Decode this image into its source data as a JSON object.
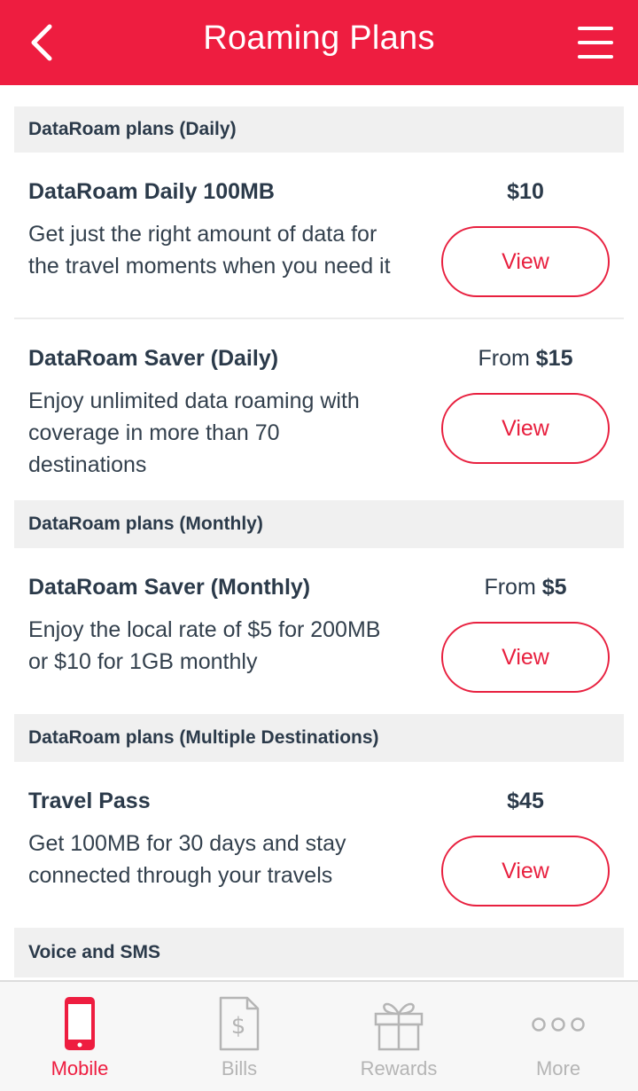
{
  "header": {
    "title": "Roaming Plans",
    "back_icon": "back-chevron-icon",
    "menu_icon": "hamburger-menu-icon",
    "accent_color": "#ee1d40"
  },
  "sections": [
    {
      "title": "DataRoam plans (Daily)",
      "plans": [
        {
          "name": "DataRoam Daily 100MB",
          "desc_line1": "Get just the right amount of data for",
          "desc_line2": "the travel moments when you need it",
          "price_prefix": "",
          "price_amount": "$10",
          "button_label": "View"
        },
        {
          "name": "DataRoam Saver (Daily)",
          "desc_line1": "Enjoy unlimited data roaming with",
          "desc_line2": "coverage in more than 70",
          "desc_line3": "destinations",
          "price_prefix": "From",
          "price_amount": "$15",
          "button_label": "View"
        }
      ]
    },
    {
      "title": "DataRoam plans (Monthly)",
      "plans": [
        {
          "name": "DataRoam Saver (Monthly)",
          "desc_line1": "Enjoy the local rate of $5 for 200MB",
          "desc_line2": "or $10 for 1GB monthly",
          "price_prefix": "From",
          "price_amount": "$5",
          "button_label": "View"
        }
      ]
    },
    {
      "title": "DataRoam plans (Multiple Destinations)",
      "plans": [
        {
          "name": "Travel Pass",
          "desc_line1": "Get 100MB for 30 days and stay",
          "desc_line2": "connected through your travels",
          "price_prefix": "",
          "price_amount": "$45",
          "button_label": "View"
        }
      ]
    },
    {
      "title": "Voice and SMS",
      "plans": []
    }
  ],
  "tab_bar": {
    "active_tab": "Mobile",
    "tabs": [
      {
        "label": "Mobile",
        "icon": "mobile-phone-icon"
      },
      {
        "label": "Bills",
        "icon": "bill-dollar-icon"
      },
      {
        "label": "Rewards",
        "icon": "gift-icon"
      },
      {
        "label": "More",
        "icon": "more-dots-icon"
      }
    ]
  }
}
